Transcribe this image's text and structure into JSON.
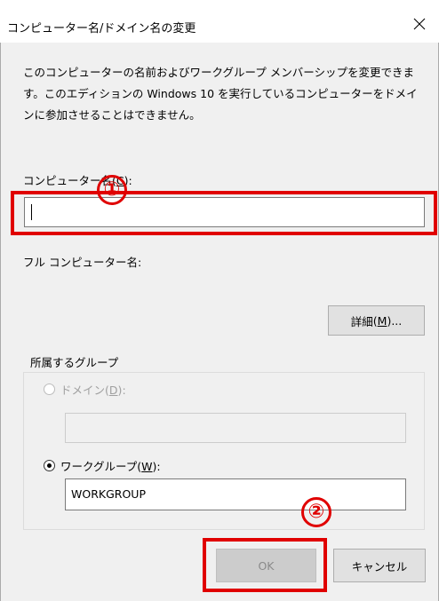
{
  "window": {
    "title": "コンピューター名/ドメイン名の変更",
    "close_glyph": "✕"
  },
  "description": "このコンピューターの名前およびワークグループ メンバーシップを変更できます。このエディションの Windows 10 を実行しているコンピューターをドメインに参加させることはできません。",
  "computer_name": {
    "label": "コンピューター名",
    "accesskey": "C",
    "suffix": ":",
    "value": ""
  },
  "full_computer_name": {
    "label": "フル コンピューター名:",
    "value": ""
  },
  "details_button": {
    "label": "詳細",
    "accesskey": "M",
    "suffix": "..."
  },
  "membership_group": {
    "legend": "所属するグループ",
    "domain": {
      "label": "ドメイン",
      "accesskey": "D",
      "suffix": ":",
      "value": "",
      "enabled": false,
      "checked": false
    },
    "workgroup": {
      "label": "ワークグループ",
      "accesskey": "W",
      "suffix": ":",
      "value": "WORKGROUP",
      "checked": true
    }
  },
  "buttons": {
    "ok": "OK",
    "ok_enabled": false,
    "cancel": "キャンセル"
  },
  "annotations": {
    "marker_1": "①",
    "marker_2": "②",
    "color": "#e00000"
  }
}
